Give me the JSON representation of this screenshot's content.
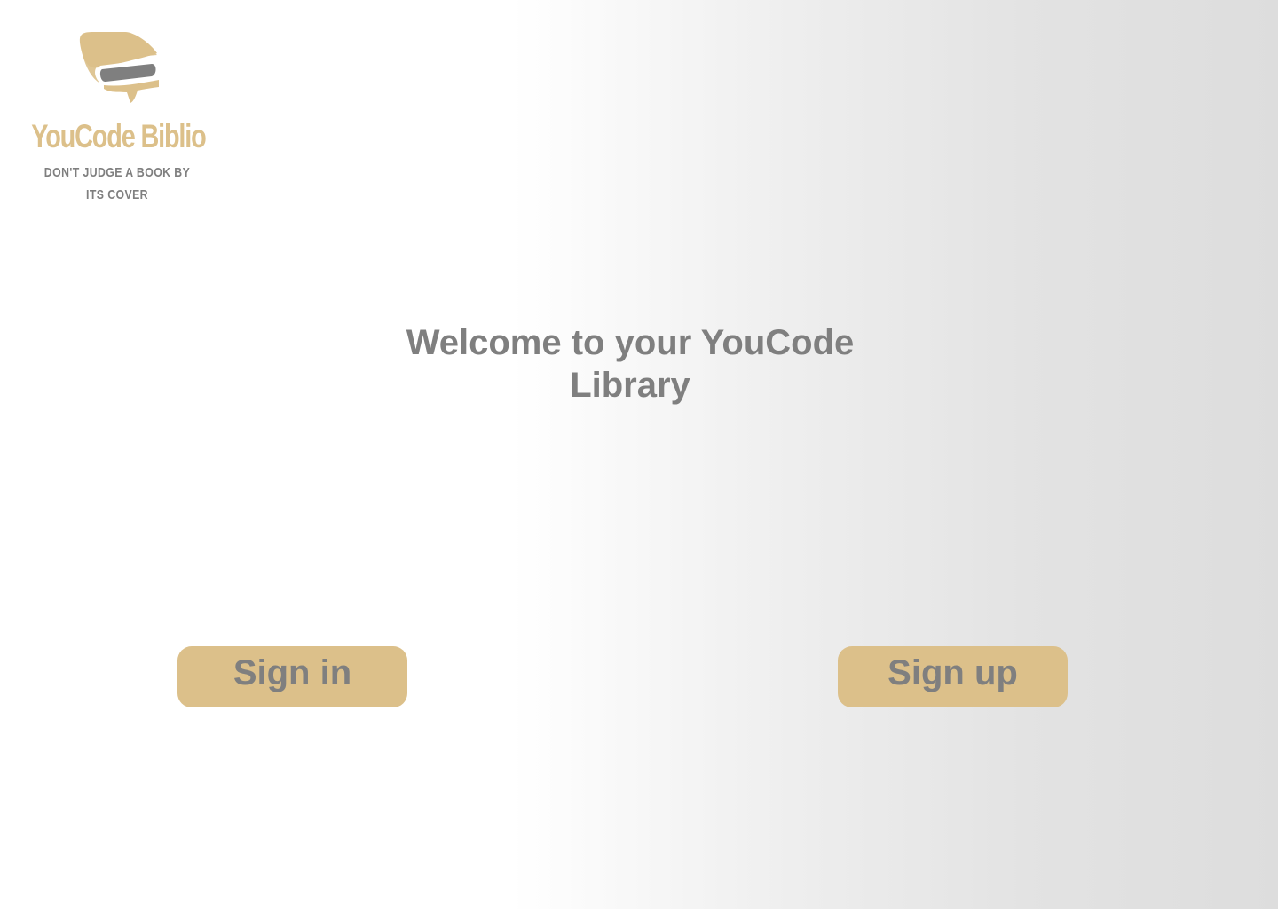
{
  "brand": {
    "name": "YouCode Biblio",
    "tagline": "DON'T JUDGE A BOOK BY ITS COVER",
    "icon": "book-logo-icon"
  },
  "main": {
    "welcome": "Welcome to your YouCode Library"
  },
  "actions": {
    "signin_label": "Sign in",
    "signup_label": "Sign up"
  },
  "colors": {
    "accent": "#dcc08a",
    "text": "#7f7f7f",
    "background_start": "#ffffff",
    "background_end": "#dddddd"
  }
}
